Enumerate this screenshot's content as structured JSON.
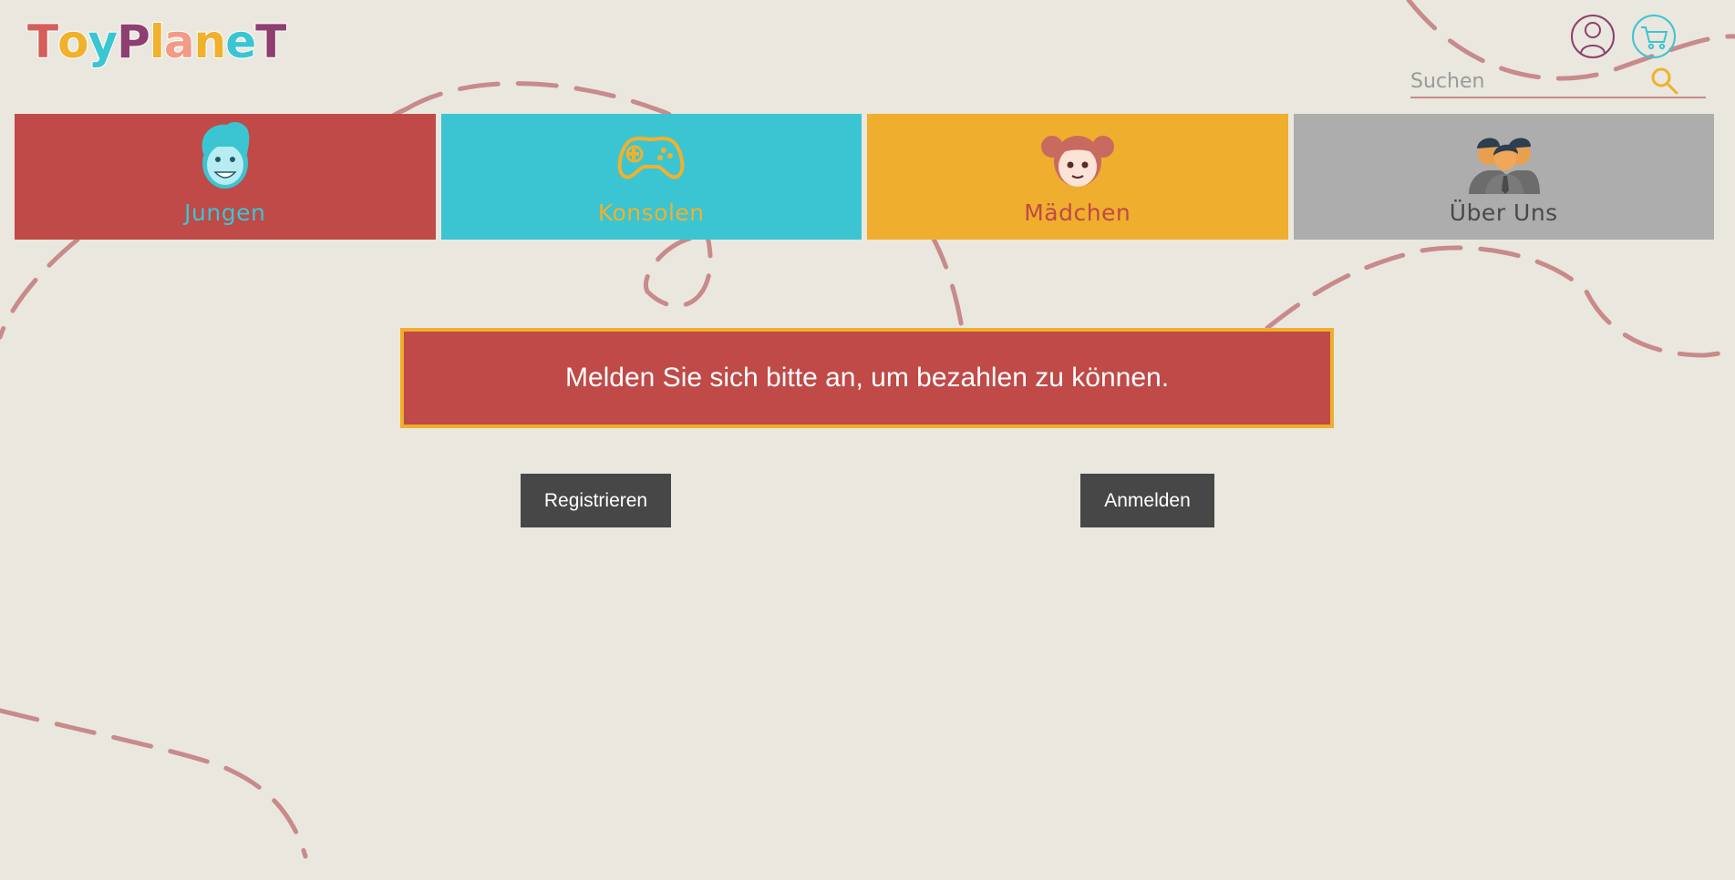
{
  "brand": {
    "logo_letters": [
      "T",
      "o",
      "y",
      "P",
      "l",
      "a",
      "n",
      "e",
      "T"
    ],
    "logo_colors": [
      "#d35e5b",
      "#f0b12d",
      "#3bc5d3",
      "#8e3e70",
      "#f0b12d",
      "#f29b86",
      "#f0b12d",
      "#3bc5d3",
      "#8e3e70"
    ]
  },
  "header": {
    "search_placeholder": "Suchen"
  },
  "nav": {
    "items": [
      {
        "label": "Jungen",
        "bg": "#bf4a47",
        "color": "#3bc5d3",
        "icon": "boy-face-icon"
      },
      {
        "label": "Konsolen",
        "bg": "#3bc5d3",
        "color": "#f0b12d",
        "icon": "gamepad-icon"
      },
      {
        "label": "Mädchen",
        "bg": "#efae2d",
        "color": "#bf4a47",
        "icon": "girl-face-icon"
      },
      {
        "label": "Über Uns",
        "bg": "#adadad",
        "color": "#4a4a4a",
        "icon": "team-icon"
      }
    ]
  },
  "alert": {
    "message": "Melden Sie sich bitte an, um bezahlen zu können."
  },
  "actions": {
    "register_label": "Registrieren",
    "login_label": "Anmelden"
  },
  "colors": {
    "background": "#eae7de",
    "dash": "#c88a8a",
    "alert_bg": "#bf4a47",
    "alert_border": "#efae2d",
    "button_bg": "#474747"
  }
}
